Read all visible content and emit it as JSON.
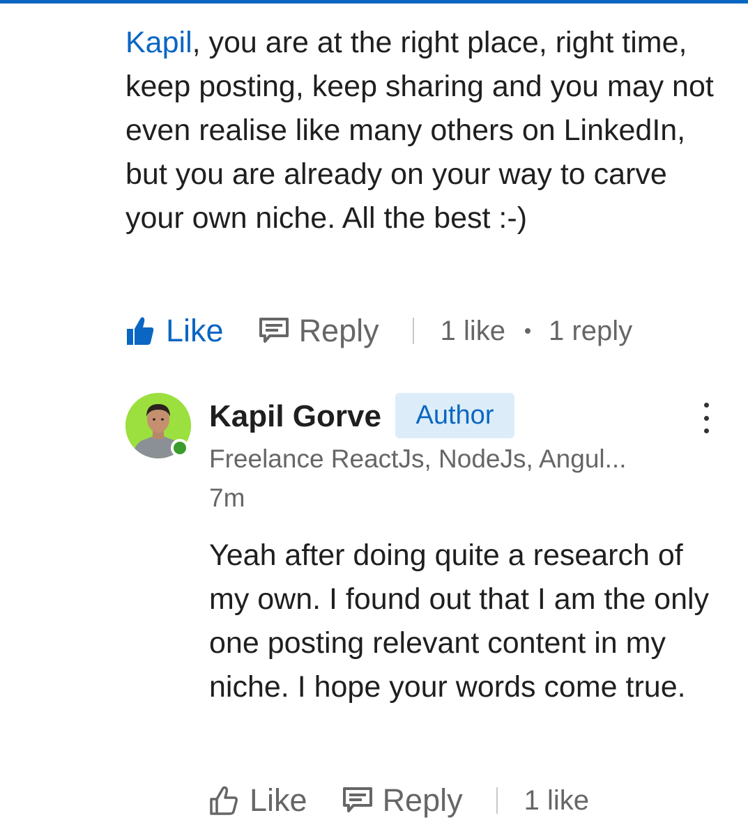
{
  "comment": {
    "mention": "Kapil",
    "text": ", you are at the right place, right time, keep posting, keep sharing and you may not even realise like many others on LinkedIn, but you are already on your way to carve your own niche. All the best :-)",
    "actions": {
      "like_label": "Like",
      "reply_label": "Reply",
      "likes_count": "1 like",
      "replies_count": "1 reply"
    }
  },
  "reply": {
    "author_name": "Kapil Gorve",
    "badge": "Author",
    "headline": "Freelance ReactJs, NodeJs, Angul...",
    "timestamp": "7m",
    "text": "Yeah after doing quite a research of my own. I found out that I am the only one posting relevant content in my niche. I hope your words come true.",
    "actions": {
      "like_label": "Like",
      "reply_label": "Reply",
      "likes_count": "1 like"
    }
  },
  "colors": {
    "brand": "#0a66c2",
    "badge_bg": "#dcedf9",
    "online": "#3a9c2b",
    "avatar_bg": "#9be03e"
  },
  "icons": {
    "like_active": "thumbs-up-filled-icon",
    "like_inactive": "thumbs-up-outline-icon",
    "reply": "speech-bubble-icon",
    "more": "vertical-ellipsis-icon"
  }
}
